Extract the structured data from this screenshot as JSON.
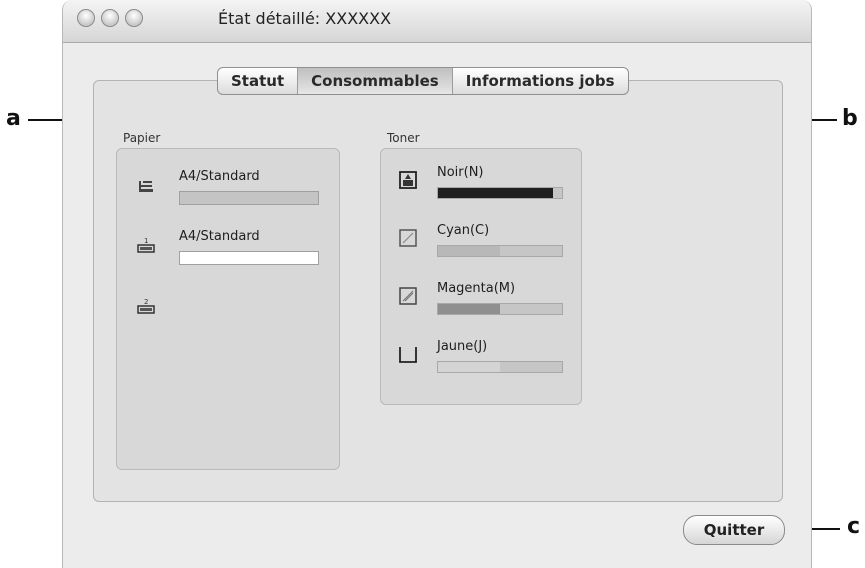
{
  "window": {
    "title": "État détaillé: XXXXXX"
  },
  "tabs": [
    {
      "label": "Statut",
      "active": false
    },
    {
      "label": "Consommables",
      "active": true
    },
    {
      "label": "Informations jobs",
      "active": false
    }
  ],
  "paper": {
    "section_label": "Papier",
    "trays": [
      {
        "icon": "paper-tray-mp-icon",
        "label": "A4/Standard",
        "state": "gray"
      },
      {
        "icon": "paper-tray-1-icon",
        "tray_number": "1",
        "label": "A4/Standard",
        "state": "white"
      },
      {
        "icon": "paper-tray-2-icon",
        "tray_number": "2",
        "label": "",
        "state": "none"
      }
    ]
  },
  "toner": {
    "section_label": "Toner",
    "items": [
      {
        "icon": "toner-black-icon",
        "label": "Noir(N)",
        "level": 0.93,
        "color": "#1f1f1f"
      },
      {
        "icon": "toner-cyan-icon",
        "label": "Cyan(C)",
        "level": 0.5,
        "color": "#b8b8b8"
      },
      {
        "icon": "toner-magenta-icon",
        "label": "Magenta(M)",
        "level": 0.5,
        "color": "#8f8f8f"
      },
      {
        "icon": "toner-yellow-icon",
        "label": "Jaune(J)",
        "level": 0.5,
        "color": "#d4d4d4"
      }
    ]
  },
  "buttons": {
    "quit_label": "Quitter"
  },
  "callouts": {
    "a": "a",
    "b": "b",
    "c": "c"
  }
}
